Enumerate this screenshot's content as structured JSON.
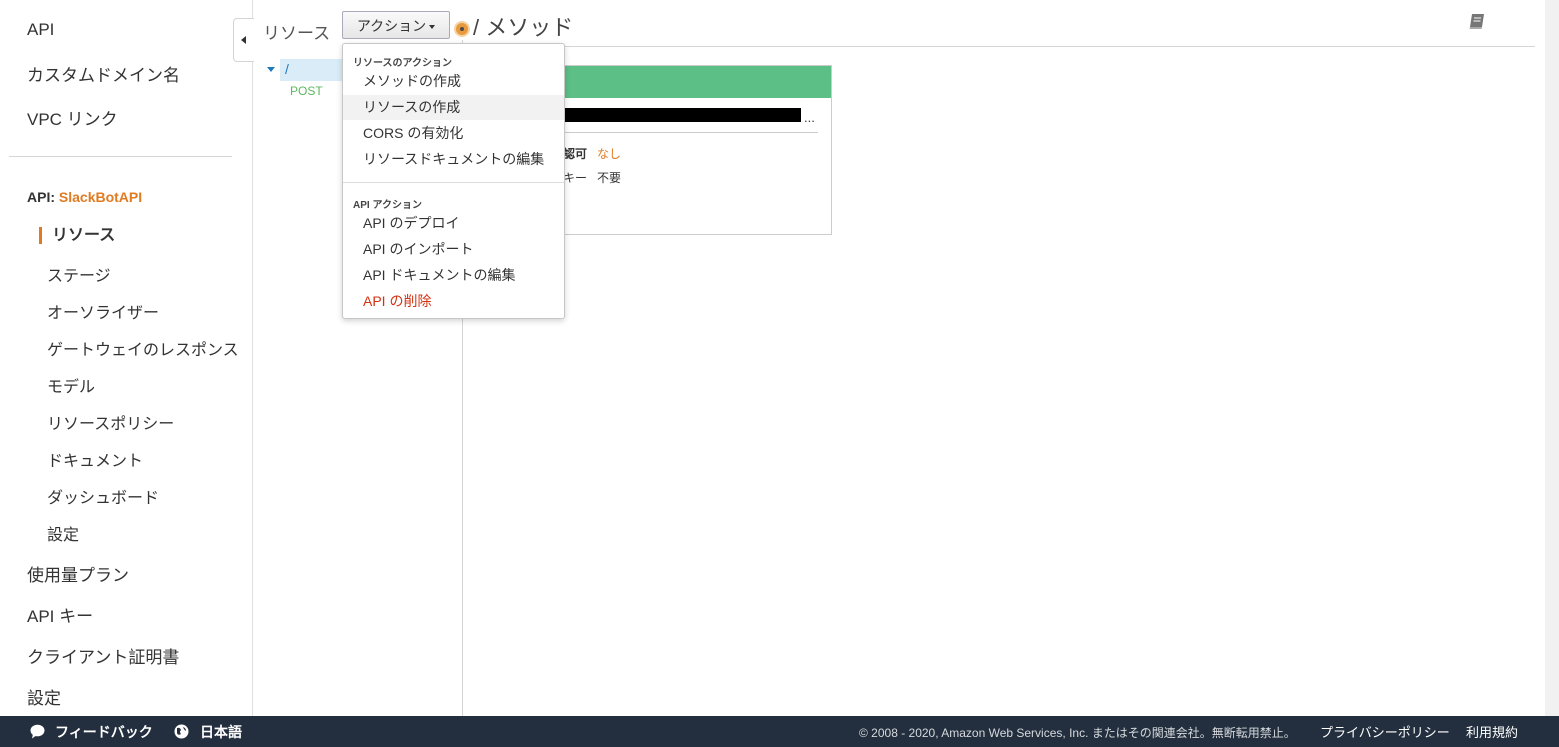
{
  "left_nav": {
    "top_items": [
      "API",
      "カスタムドメイン名",
      "VPC リンク"
    ],
    "api_prefix": "API:",
    "api_name": "SlackBotAPI",
    "active_item": "リソース",
    "sub_items": [
      "ステージ",
      "オーソライザー",
      "ゲートウェイのレスポンス",
      "モデル",
      "リソースポリシー",
      "ドキュメント",
      "ダッシュボード",
      "設定"
    ],
    "bottom_items": [
      "使用量プラン",
      "API キー",
      "クライアント証明書",
      "設定"
    ]
  },
  "resources": {
    "title": "リソース",
    "actions_label": "アクション",
    "tree_root": "/",
    "tree_method": "POST"
  },
  "main": {
    "title": "/ メソッド",
    "card": {
      "auth_label": "認可",
      "auth_value": "なし",
      "apikey_label": "キー",
      "apikey_value": "不要",
      "ellipsis": "..."
    }
  },
  "dropdown": {
    "resource_header": "リソースのアクション",
    "resource_items": [
      "メソッドの作成",
      "リソースの作成",
      "CORS の有効化",
      "リソースドキュメントの編集"
    ],
    "api_header": "API アクション",
    "api_items": [
      "API のデプロイ",
      "API のインポート",
      "API ドキュメントの編集",
      "API の削除"
    ]
  },
  "footer": {
    "feedback": "フィードバック",
    "language": "日本語",
    "copyright": "© 2008 - 2020, Amazon Web Services, Inc. またはその関連会社。無断転用禁止。",
    "privacy": "プライバシーポリシー",
    "terms": "利用規約"
  },
  "colors": {
    "accent": "#e07b21",
    "method_green": "#5cbf86",
    "danger": "#d13212",
    "footer_bg": "#232f3e"
  }
}
